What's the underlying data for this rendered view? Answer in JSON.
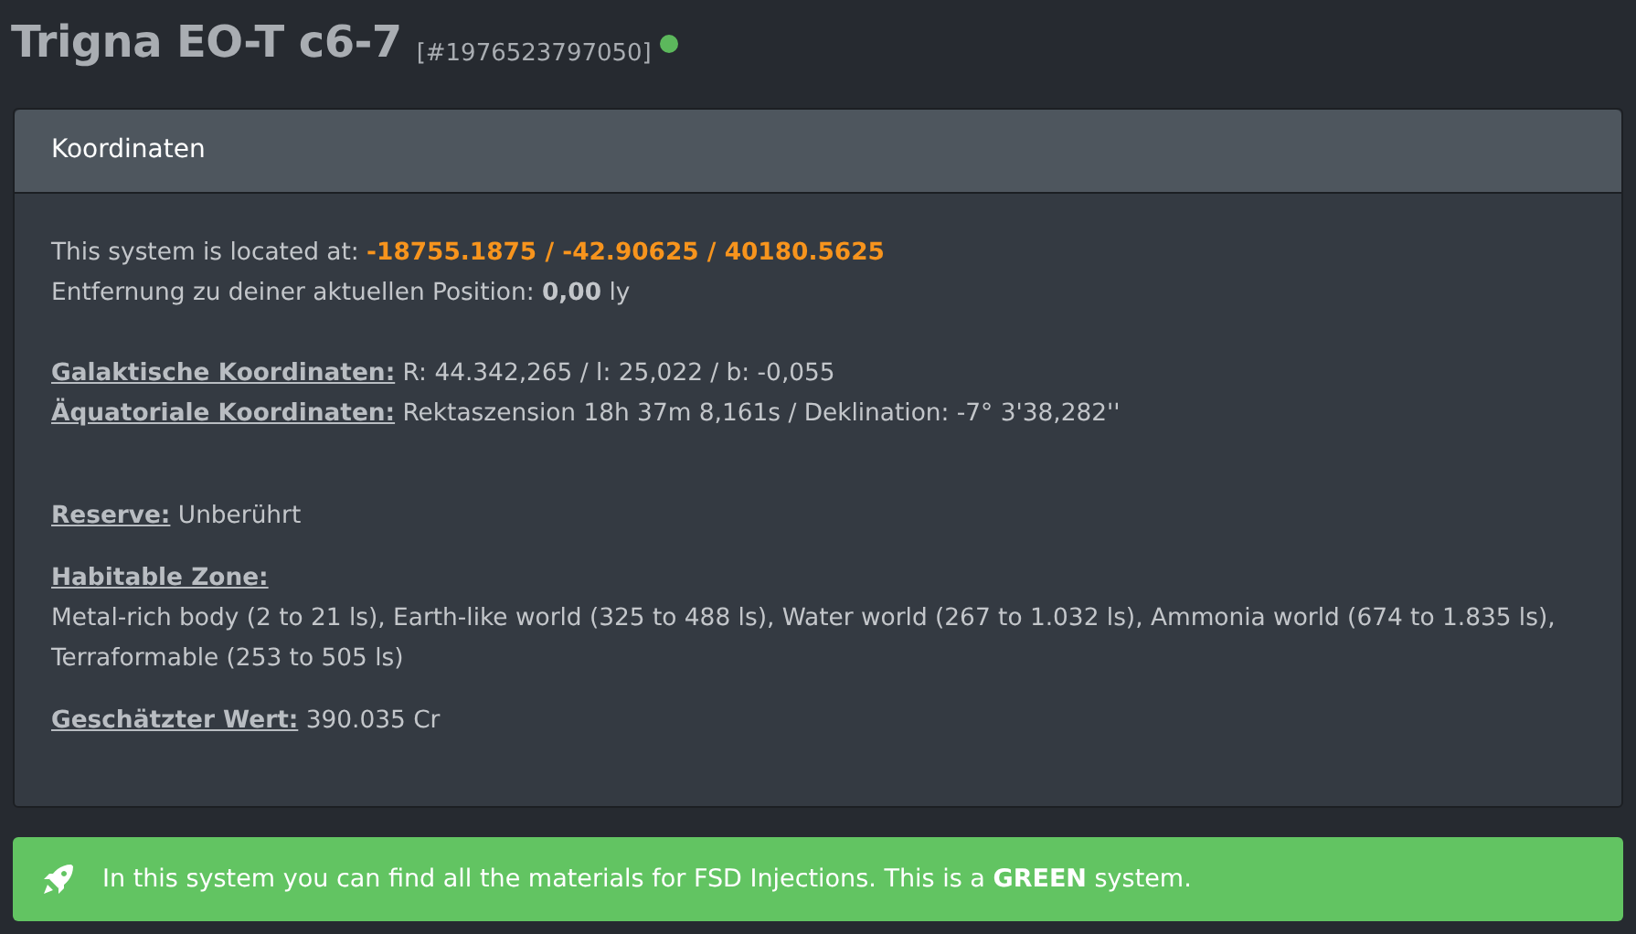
{
  "title": {
    "name": "Trigna EO-T c6-7",
    "id": "[#1976523797050]",
    "status": {
      "color": "#5cb85c"
    }
  },
  "panel": {
    "heading": "Koordinaten",
    "location": {
      "text": "This system is located at: ",
      "coordinates": "-18755.1875 / -42.90625 / 40180.5625"
    },
    "distance": "Entfernung zu deiner aktuellen Position: **0,00** ly",
    "coordinate_lines": [
      {
        "label": "Galaktische Koordinaten:",
        "value": "R: 44.342,265 / l: 25,022 / b: -0,055"
      },
      {
        "label": "Äquatoriale Koordinaten:",
        "value": "Rektaszension 18h 37m 8,161s / Deklination: -7° 3'38,282''"
      }
    ],
    "reserve": {
      "label": "Reserve:",
      "value": "Unberührt"
    },
    "habitable_zone": {
      "label": "Habitable Zone:",
      "value": "Metal-rich body (2 to 21 ls), Earth-like world (325 to 488 ls), Water world (267 to 1.032 ls), Ammonia world (674 to 1.835 ls), Terraformable (253 to 505 ls)"
    },
    "value": {
      "label": "Geschätzter Wert:",
      "value": "390.035 Cr"
    }
  },
  "alert": {
    "text": "In this system you can find all the materials for FSD Injections. This is a **GREEN** system."
  }
}
